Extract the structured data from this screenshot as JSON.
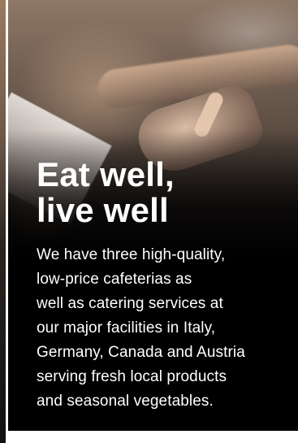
{
  "card": {
    "headline": {
      "line1": "Eat well,",
      "line2": "live well"
    },
    "body": {
      "lines": [
        "We have three high-quality,",
        "low-price cafeterias as",
        "well as catering services at",
        "our major facilities in Italy,",
        "Germany, Canada and Austria",
        "serving fresh local products",
        "and seasonal vegetables."
      ]
    }
  },
  "colors": {
    "text": "#ffffff",
    "background": "#000000",
    "page": "#ffffff"
  }
}
